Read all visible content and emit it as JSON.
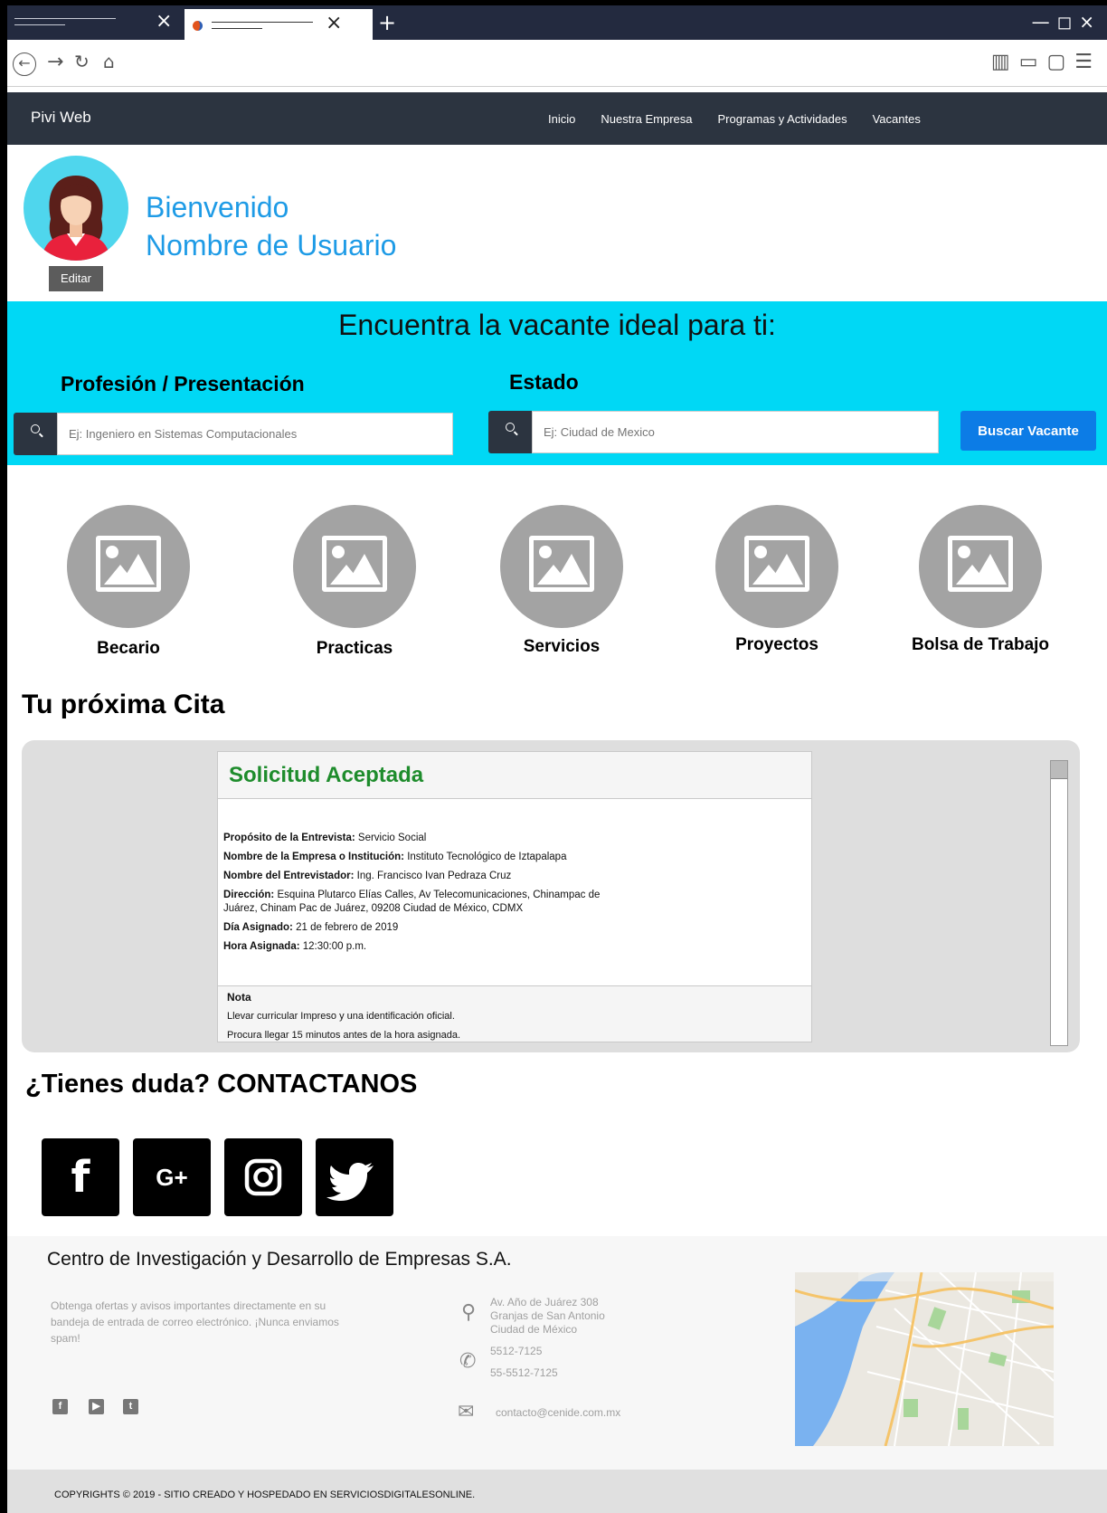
{
  "browser": {
    "tab_close": "×",
    "new_tab": "+",
    "window_controls": "—◻×"
  },
  "navbar": {
    "brand": "Pivi Web",
    "items": [
      "Inicio",
      "Nuestra Empresa",
      "Programas y Actividades",
      "Vacantes"
    ]
  },
  "profile": {
    "edit_label": "Editar",
    "welcome_line1": "Bienvenido",
    "welcome_line2": "Nombre de Usuario"
  },
  "search": {
    "title": "Encuentra la vacante ideal para ti:",
    "profession_label": "Profesión / Presentación",
    "profession_placeholder": "Ej: Ingeniero en Sistemas Computacionales",
    "state_label": "Estado",
    "state_placeholder": "Ej: Ciudad de Mexico",
    "button": "Buscar Vacante"
  },
  "categories": [
    "Becario",
    "Practicas",
    "Servicios",
    "Proyectos",
    "Bolsa de Trabajo"
  ],
  "appointment": {
    "section_title": "Tu próxima Cita",
    "status": "Solicitud Aceptada",
    "fields": [
      {
        "label": "Propósito de la Entrevista:",
        "value": "Servicio Social"
      },
      {
        "label": "Nombre de la Empresa o Institución:",
        "value": "Instituto Tecnológico de Iztapalapa"
      },
      {
        "label": "Nombre del Entrevistador:",
        "value": "Ing. Francisco Ivan Pedraza Cruz"
      },
      {
        "label": "Dirección:",
        "value": "Esquina Plutarco Elías Calles, Av Telecomunicaciones, Chinampac de Juárez, Chinam Pac de Juárez, 09208 Ciudad de México, CDMX"
      },
      {
        "label": "Día Asignado:",
        "value": "21 de febrero de 2019"
      },
      {
        "label": "Hora Asignada:",
        "value": "12:30:00 p.m."
      }
    ],
    "note_title": "Nota",
    "note_lines": [
      "Llevar curricular Impreso y una identificación oficial.",
      "Procura llegar 15 minutos antes de la hora asignada."
    ]
  },
  "contact": {
    "title": "¿Tienes duda?  CONTACTANOS",
    "social": [
      {
        "icon": "facebook-icon",
        "glyph": "f"
      },
      {
        "icon": "google-plus-icon",
        "glyph": "G+"
      },
      {
        "icon": "instagram-icon",
        "glyph": ""
      },
      {
        "icon": "twitter-icon",
        "glyph": ""
      }
    ]
  },
  "footer": {
    "company": "Centro de Investigación y Desarrollo de Empresas S.A.",
    "newsletter": "Obtenga ofertas y avisos importantes directamente en su bandeja de entrada de correo electrónico. ¡Nunca enviamos spam!",
    "address": [
      "Av. Año de Juárez 308",
      "Granjas de San Antonio",
      "Ciudad de México"
    ],
    "phones": [
      "5512-7125",
      "55-5512-7125"
    ],
    "email": "contacto@cenide.com.mx",
    "copyright": "COPYRIGHTS © 2019 - SITIO CREADO Y HOSPEDADO EN SERVICIOSDIGITALESONLINE."
  },
  "colors": {
    "accent_cyan": "#00d8f5",
    "navbar": "#2c3440",
    "button_blue": "#0c7ce6",
    "welcome_blue": "#1e9be6",
    "accepted_green": "#1e8c2c"
  }
}
